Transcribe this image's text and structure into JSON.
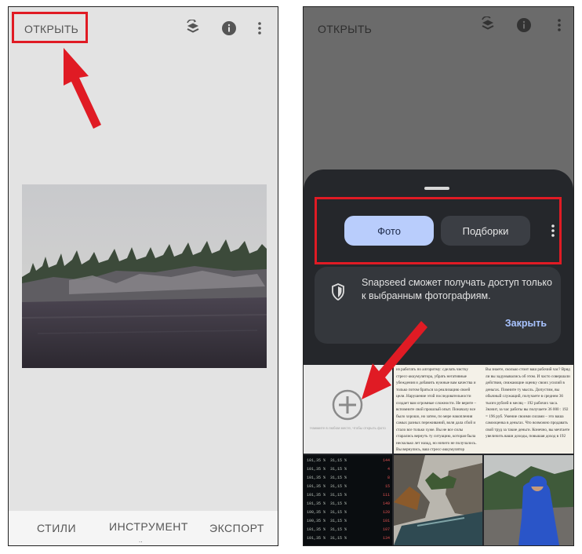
{
  "left_screen": {
    "open_label": "ОТКРЫТЬ",
    "icons": [
      "layers-rotate-icon",
      "info-icon",
      "more-vert-icon"
    ],
    "bottom_nav": {
      "styles": "СТИЛИ",
      "tools": "ИНСТРУМЕНТ",
      "export": "ЭКСПОРТ"
    }
  },
  "right_screen": {
    "open_label": "ОТКРЫТЬ",
    "tabs": {
      "photo": "Фото",
      "collections": "Подборки"
    },
    "notice": {
      "text": "Snapseed сможет получать доступ только к выбранным фотографиям.",
      "close": "Закрыть"
    },
    "add_tile_hint": "Нажмите в любом месте, чтобы открыть фото",
    "doc_col1": "из работать по алгоритму: сделать чистку стресс-аккумулятора, убрать негативные убеждения и добавить нужные вам качества и только потом браться за реализацию своей цели. Нарушение этой последовательности создает вам огромные сложности. Не верите – вспомните свой прошлый опыт. Поначалу все было хорошо, но затем, по мере накопления самых разных переживаний, воля дала сбой и стало все только хуже. Вы не все силы старались вернуть ту ситуацию, которая была несколько лет назад, но ничего не получалось. Вы вернулись, ваш стресс-аккумулятор переполнен",
    "doc_col2": "Вы знаете, сколько стоит ваш рабочий час? Вряд ли вы задумывались об этом. И часто совершали действия, снижающие оценку своих усилий в деньгах. Помните ту мысль. Допустим, вы обычный служащий, получаете в среднем 36 тысяч рублей в месяц – 192 рабочих часа. Значит, за час работы вы получаете 36 000 : 192 = 196 руб. Умение своими силами – это ваша самооценка в деньгах. Что возможно продавать свой труд за такие деньги. Конечно, вы мечтаете увеличить ваши доходы, повышая доход в 192",
    "data_rows": [
      [
        "101,35 %",
        "31,15 %",
        "144"
      ],
      [
        "101,35 %",
        "31,15 %",
        "4"
      ],
      [
        "101,35 %",
        "31,15 %",
        "8"
      ],
      [
        "101,35 %",
        "31,15 %",
        "15"
      ],
      [
        "101,35 %",
        "31,15 %",
        "111"
      ],
      [
        "101,35 %",
        "31,15 %",
        "149"
      ],
      [
        "100,35 %",
        "31,15 %",
        "120"
      ],
      [
        "100,35 %",
        "31,15 %",
        "101"
      ],
      [
        "101,35 %",
        "31,15 %",
        "107"
      ],
      [
        "101,35 %",
        "31,15 %",
        "134"
      ]
    ]
  },
  "colors": {
    "highlight": "#e01b24",
    "photo_tab_bg": "#b9cdfc",
    "collections_tab_bg": "#3b3e44",
    "close_link": "#a8c3ff"
  }
}
